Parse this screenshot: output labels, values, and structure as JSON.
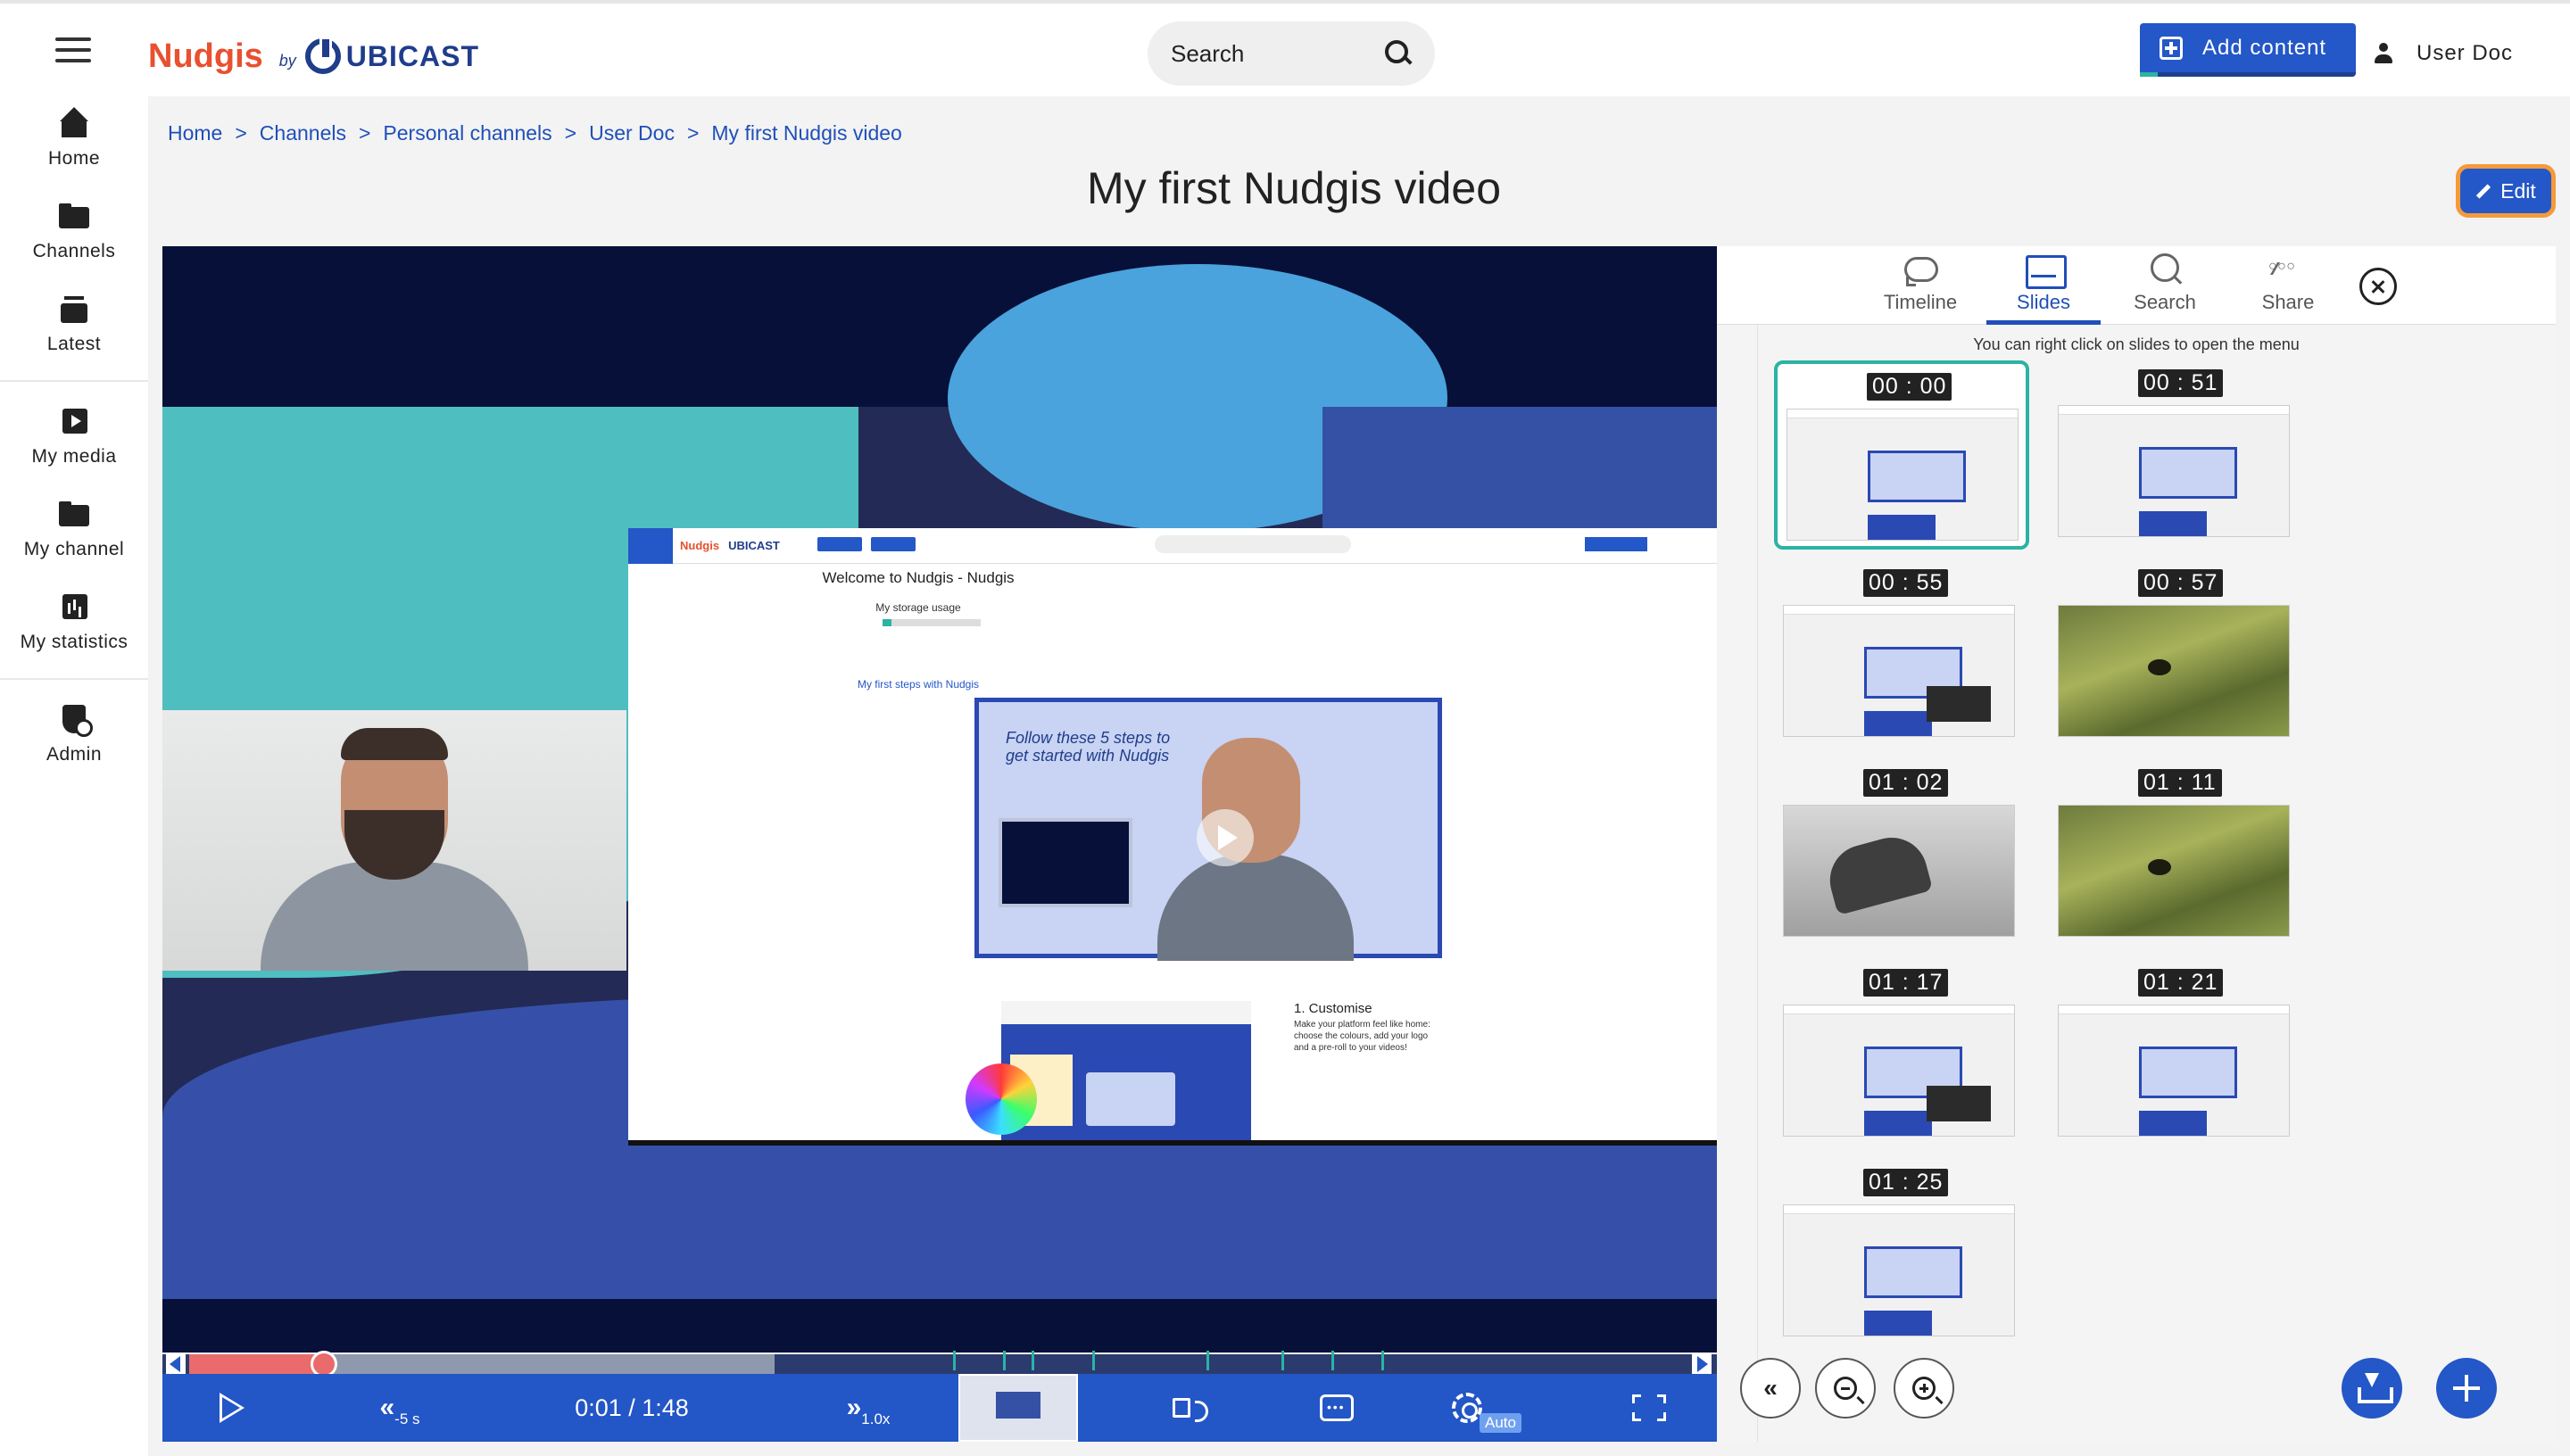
{
  "header": {
    "logo_brand": "Nudgis",
    "logo_by": "by",
    "logo_company": "UBICAST",
    "search_placeholder": "Search",
    "add_content_label": "Add content",
    "user_label": "User Doc"
  },
  "sidebar": {
    "items": [
      {
        "label": "Home",
        "icon": "home-icon"
      },
      {
        "label": "Channels",
        "icon": "folder-icon"
      },
      {
        "label": "Latest",
        "icon": "latest-icon"
      },
      {
        "label": "My media",
        "icon": "media-icon"
      },
      {
        "label": "My channel",
        "icon": "folder-icon"
      },
      {
        "label": "My statistics",
        "icon": "stats-icon"
      },
      {
        "label": "Admin",
        "icon": "admin-icon"
      }
    ]
  },
  "breadcrumb": {
    "items": [
      "Home",
      "Channels",
      "Personal channels",
      "User Doc",
      "My first Nudgis video"
    ],
    "separator": ">"
  },
  "page": {
    "title": "My first Nudgis video",
    "edit_label": "Edit"
  },
  "player": {
    "slide_title": "Welcome to Nudgis - Nudgis",
    "slide_storage_label": "My storage usage",
    "slide_steps_label": "My first steps with Nudgis",
    "slide_handwriting": "Follow these 5 steps to get started with Nudgis",
    "slide_customise_title": "1. Customise",
    "slide_customise_text": "Make your platform feel like home: choose the colours, add your logo and a pre-roll to your videos!",
    "progress_played_fraction": 0.09,
    "progress_buffered_fraction": 0.39,
    "rewind_label": "-5 s",
    "time_display": "0:01 / 1:48",
    "speed_label": "1.0x",
    "quality_label": "Auto"
  },
  "panel": {
    "tabs": [
      {
        "label": "Timeline",
        "icon": "timeline-icon"
      },
      {
        "label": "Slides",
        "icon": "slides-icon"
      },
      {
        "label": "Search",
        "icon": "search-icon"
      },
      {
        "label": "Share",
        "icon": "share-icon"
      }
    ],
    "active_tab": "Slides",
    "hint": "You can right click on slides to open the menu",
    "slides": [
      {
        "time": "00 : 00",
        "kind": "screen"
      },
      {
        "time": "00 : 51",
        "kind": "screen"
      },
      {
        "time": "00 : 55",
        "kind": "screen-popup"
      },
      {
        "time": "00 : 57",
        "kind": "pond"
      },
      {
        "time": "01 : 02",
        "kind": "street"
      },
      {
        "time": "01 : 11",
        "kind": "pond"
      },
      {
        "time": "01 : 17",
        "kind": "screen-popup"
      },
      {
        "time": "01 : 21",
        "kind": "screen"
      },
      {
        "time": "01 : 25",
        "kind": "screen"
      }
    ]
  },
  "colors": {
    "accent": "#2457c7",
    "brand_orange": "#e8502f",
    "selected_border": "#2bb3a3",
    "edit_focus_ring": "#f49a3b",
    "progress_played": "#e96b6b"
  }
}
